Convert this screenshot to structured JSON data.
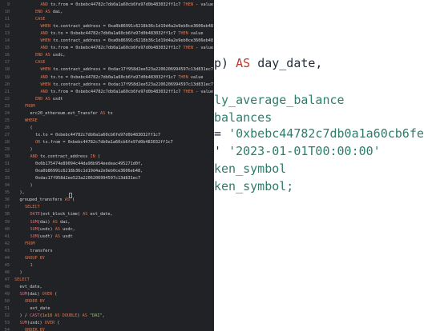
{
  "editor_lines": [
    {
      "num": "9",
      "indent": 5,
      "tokens": [
        [
          "kw",
          "AND "
        ],
        [
          "txt",
          "tx.from = 0xbebc44782c7db0a1a60cb6fe97d0b483032ff1c7 "
        ],
        [
          "kw",
          "THEN "
        ],
        [
          "txt",
          "- value"
        ]
      ]
    },
    {
      "num": "10",
      "indent": 4,
      "tokens": [
        [
          "kw",
          "END AS "
        ],
        [
          "txt",
          "dai,"
        ]
      ]
    },
    {
      "num": "11",
      "indent": 4,
      "tokens": [
        [
          "kw",
          "CASE"
        ]
      ]
    },
    {
      "num": "12",
      "indent": 5,
      "tokens": [
        [
          "kw",
          "WHEN "
        ],
        [
          "txt",
          "tx.contract_address = 0xa0b86991c6218b36c1d19d4a2e9eb0ce3606eb48"
        ]
      ]
    },
    {
      "num": "13",
      "indent": 5,
      "tokens": [
        [
          "kw",
          "AND "
        ],
        [
          "txt",
          "tx.to = 0xbebc44782c7db0a1a60cb6fe97d0b483032ff1c7 "
        ],
        [
          "kw",
          "THEN "
        ],
        [
          "txt",
          "value"
        ]
      ]
    },
    {
      "num": "14",
      "indent": 5,
      "tokens": [
        [
          "kw",
          "WHEN "
        ],
        [
          "txt",
          "tx.contract_address = 0xa0b86991c6218b36c1d19d4a2e9eb0ce3606eb48"
        ]
      ]
    },
    {
      "num": "15",
      "indent": 5,
      "tokens": [
        [
          "kw",
          "AND "
        ],
        [
          "txt",
          "tx.from = 0xbebc44782c7db0a1a60cb6fe97d0b483032ff1c7 "
        ],
        [
          "kw",
          "THEN "
        ],
        [
          "txt",
          "- value"
        ]
      ]
    },
    {
      "num": "16",
      "indent": 4,
      "tokens": [
        [
          "kw",
          "END AS "
        ],
        [
          "txt",
          "usdc,"
        ]
      ]
    },
    {
      "num": "17",
      "indent": 4,
      "tokens": [
        [
          "kw",
          "CASE"
        ]
      ]
    },
    {
      "num": "18",
      "indent": 5,
      "tokens": [
        [
          "kw",
          "WHEN "
        ],
        [
          "txt",
          "tx.contract_address = 0xdac17f958d2ee523a2206206994597c13d831ec7"
        ]
      ]
    },
    {
      "num": "19",
      "indent": 5,
      "tokens": [
        [
          "kw",
          "AND "
        ],
        [
          "txt",
          "tx.to = 0xbebc44782c7db0a1a60cb6fe97d0b483032ff1c7 "
        ],
        [
          "kw",
          "THEN "
        ],
        [
          "txt",
          "value"
        ]
      ]
    },
    {
      "num": "20",
      "indent": 5,
      "tokens": [
        [
          "kw",
          "WHEN "
        ],
        [
          "txt",
          "tx.contract_address = 0xdac17f958d2ee523a2206206994597c13d831ec7"
        ]
      ]
    },
    {
      "num": "21",
      "indent": 5,
      "tokens": [
        [
          "kw",
          "AND "
        ],
        [
          "txt",
          "tx.from = 0xbebc44782c7db0a1a60cb6fe97d0b483032ff1c7 "
        ],
        [
          "kw",
          "THEN "
        ],
        [
          "txt",
          "- value"
        ]
      ]
    },
    {
      "num": "22",
      "indent": 4,
      "tokens": [
        [
          "kw",
          "END AS "
        ],
        [
          "txt",
          "usdt"
        ]
      ]
    },
    {
      "num": "23",
      "indent": 2,
      "tokens": [
        [
          "kw",
          "FROM"
        ]
      ]
    },
    {
      "num": "24",
      "indent": 3,
      "tokens": [
        [
          "txt",
          "erc20_ethereum.evt_Transfer "
        ],
        [
          "kw",
          "AS "
        ],
        [
          "txt",
          "tx"
        ]
      ]
    },
    {
      "num": "25",
      "indent": 2,
      "tokens": [
        [
          "kw",
          "WHERE"
        ]
      ]
    },
    {
      "num": "26",
      "indent": 3,
      "tokens": [
        [
          "txt",
          "("
        ]
      ]
    },
    {
      "num": "27",
      "indent": 4,
      "tokens": [
        [
          "txt",
          "tx.to = 0xbebc44782c7db0a1a60cb6fe97d0b483032ff1c7"
        ]
      ]
    },
    {
      "num": "28",
      "indent": 4,
      "tokens": [
        [
          "kw",
          "OR "
        ],
        [
          "txt",
          "tx.from = 0xbebc44782c7db0a1a60cb6fe97d0b483032ff1c7"
        ]
      ]
    },
    {
      "num": "29",
      "indent": 3,
      "tokens": [
        [
          "txt",
          ")"
        ]
      ]
    },
    {
      "num": "30",
      "indent": 3,
      "tokens": [
        [
          "kw",
          "AND "
        ],
        [
          "txt",
          "tx.contract_address "
        ],
        [
          "kw",
          "IN "
        ],
        [
          "txt",
          "("
        ]
      ]
    },
    {
      "num": "31",
      "indent": 4,
      "tokens": [
        [
          "txt",
          "0x6b175474e89094c44da98b954eedeac495271d0f,"
        ]
      ]
    },
    {
      "num": "32",
      "indent": 4,
      "tokens": [
        [
          "txt",
          "0xa0b86991c6218b36c1d19d4a2e9eb0ce3606eb48,"
        ]
      ]
    },
    {
      "num": "33",
      "indent": 4,
      "tokens": [
        [
          "txt",
          "0xdac17f958d2ee523a2206206994597c13d831ec7"
        ]
      ]
    },
    {
      "num": "34",
      "indent": 3,
      "tokens": [
        [
          "txt",
          ")"
        ]
      ]
    },
    {
      "num": "35",
      "indent": 1,
      "tokens": [
        [
          "txt",
          "),"
        ]
      ]
    },
    {
      "num": "36",
      "indent": 1,
      "tokens": [
        [
          "txt",
          "grouped_transfers "
        ],
        [
          "kw",
          "AS "
        ],
        [
          "txt",
          "("
        ]
      ]
    },
    {
      "num": "37",
      "indent": 2,
      "tokens": [
        [
          "kw",
          "SELECT"
        ]
      ]
    },
    {
      "num": "38",
      "indent": 3,
      "tokens": [
        [
          "fn",
          "DATE"
        ],
        [
          "txt",
          "(evt_block_time) "
        ],
        [
          "kw",
          "AS "
        ],
        [
          "txt",
          "evt_date,"
        ]
      ]
    },
    {
      "num": "39",
      "indent": 3,
      "tokens": [
        [
          "fn",
          "SUM"
        ],
        [
          "txt",
          "(dai) "
        ],
        [
          "kw",
          "AS "
        ],
        [
          "txt",
          "dai,"
        ]
      ]
    },
    {
      "num": "40",
      "indent": 3,
      "tokens": [
        [
          "fn",
          "SUM"
        ],
        [
          "txt",
          "(usdc) "
        ],
        [
          "kw",
          "AS "
        ],
        [
          "txt",
          "usdc,"
        ]
      ]
    },
    {
      "num": "41",
      "indent": 3,
      "tokens": [
        [
          "fn",
          "SUM"
        ],
        [
          "txt",
          "(usdt) "
        ],
        [
          "kw",
          "AS "
        ],
        [
          "txt",
          "usdt"
        ]
      ]
    },
    {
      "num": "42",
      "indent": 2,
      "tokens": [
        [
          "kw",
          "FROM"
        ]
      ]
    },
    {
      "num": "43",
      "indent": 3,
      "tokens": [
        [
          "txt",
          "transfers"
        ]
      ]
    },
    {
      "num": "44",
      "indent": 2,
      "tokens": [
        [
          "kw",
          "GROUP BY"
        ]
      ]
    },
    {
      "num": "45",
      "indent": 3,
      "tokens": [
        [
          "num",
          "1"
        ]
      ]
    },
    {
      "num": "46",
      "indent": 1,
      "tokens": [
        [
          "txt",
          ")"
        ]
      ]
    },
    {
      "num": "47",
      "indent": 0,
      "tokens": [
        [
          "kw",
          "SELECT"
        ]
      ]
    },
    {
      "num": "48",
      "indent": 1,
      "tokens": [
        [
          "txt",
          "evt_date,"
        ]
      ]
    },
    {
      "num": "49",
      "indent": 1,
      "tokens": [
        [
          "fn",
          "SUM"
        ],
        [
          "txt",
          "(dai) "
        ],
        [
          "kw",
          "OVER "
        ],
        [
          "txt",
          "("
        ]
      ]
    },
    {
      "num": "50",
      "indent": 2,
      "tokens": [
        [
          "kw",
          "ORDER BY"
        ]
      ]
    },
    {
      "num": "51",
      "indent": 3,
      "tokens": [
        [
          "txt",
          "evt_date"
        ]
      ]
    },
    {
      "num": "52",
      "indent": 1,
      "tokens": [
        [
          "txt",
          ") / "
        ],
        [
          "fn",
          "CAST"
        ],
        [
          "txt",
          "("
        ],
        [
          "num",
          "1e18"
        ],
        [
          "kw",
          " AS DOUBLE"
        ],
        [
          "txt",
          ") "
        ],
        [
          "kw",
          "AS "
        ],
        [
          "str",
          "\"DAI\""
        ],
        [
          "txt",
          ","
        ]
      ]
    },
    {
      "num": "53",
      "indent": 1,
      "tokens": [
        [
          "fn",
          "SUM"
        ],
        [
          "txt",
          "(usdc) "
        ],
        [
          "kw",
          "OVER "
        ],
        [
          "txt",
          "("
        ]
      ]
    },
    {
      "num": "54",
      "indent": 2,
      "tokens": [
        [
          "kw",
          "ORDER BY"
        ]
      ]
    }
  ],
  "right_lines": [
    [
      [
        "def",
        "p) "
      ],
      [
        "kw",
        "AS "
      ],
      [
        "def",
        "day_date,"
      ]
    ],
    [
      [
        "teal",
        "ly_average_balance"
      ]
    ],
    [
      [
        "teal",
        "balances"
      ]
    ],
    [
      [
        "def",
        "= "
      ],
      [
        "str",
        "'0xbebc44782c7db0a1a60cb6fe"
      ]
    ],
    [
      [
        "def",
        "' "
      ],
      [
        "str",
        "'2023-01-01T00:00:00'"
      ]
    ],
    [
      [
        "teal",
        "ken_symbol"
      ]
    ],
    [
      [
        "teal",
        "ken_symbol;"
      ]
    ]
  ]
}
